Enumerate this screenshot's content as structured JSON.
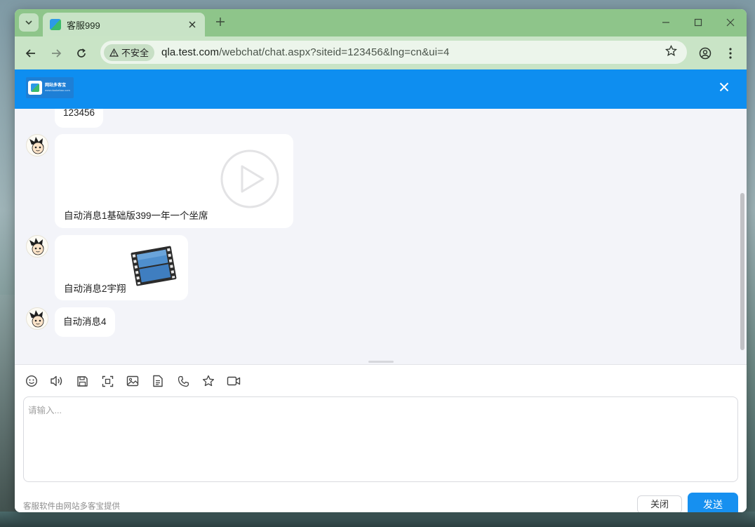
{
  "browser": {
    "tab_title": "客服999",
    "url_host": "qla.test.com",
    "url_path": "/webchat/chat.aspx?siteid=123456&lng=cn&ui=4",
    "security_label": "不安全"
  },
  "chat": {
    "logo_line1": "网站多客宝",
    "logo_line2": "www.duokebao.com",
    "messages": [
      {
        "text": "123456"
      },
      {
        "text": "自动消息1基础版399一年一个坐席",
        "media": "video-play-icon"
      },
      {
        "text": "自动消息2宇翔",
        "media": "film-strip-icon"
      },
      {
        "text": "自动消息4"
      }
    ]
  },
  "composer": {
    "placeholder": "请输入...",
    "footer_note": "客服软件由网站多客宝提供",
    "close_label": "关闭",
    "send_label": "发送",
    "tools": [
      "emoji-icon",
      "voice-icon",
      "save-icon",
      "screenshot-icon",
      "image-icon",
      "file-icon",
      "phone-icon",
      "star-icon",
      "video-icon"
    ]
  },
  "colors": {
    "tab_bar": "#8ec58a",
    "toolbar": "#c9e4c6",
    "header": "#0e8ef0",
    "send_button": "#1690f0",
    "chat_bg": "#f3f4f9"
  }
}
